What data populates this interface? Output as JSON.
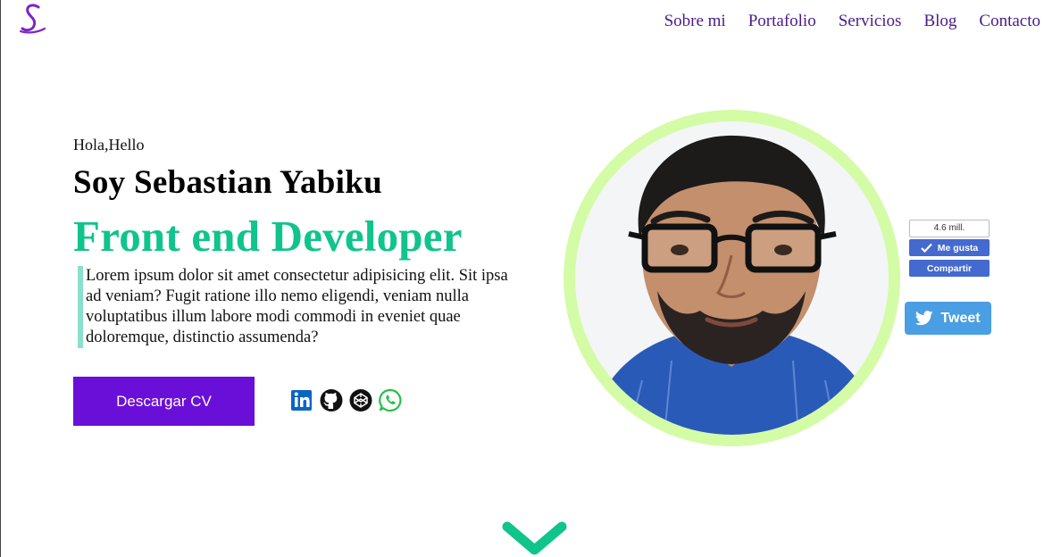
{
  "logo": {
    "glyph": "S",
    "icon": "signature-logo",
    "color": "#7a26c8"
  },
  "nav": {
    "items": [
      "Sobre mi",
      "Portafolio",
      "Servicios",
      "Blog",
      "Contacto"
    ],
    "color": "#4a1a8a"
  },
  "hero": {
    "greeting": "Hola,Hello",
    "name": "Soy Sebastian Yabiku",
    "role": "Front end Developer",
    "bio": "Lorem ipsum dolor sit amet consectetur adipisicing elit. Sit ipsa ad veniam? Fugit ratione illo nemo eligendi, veniam nulla voluptatibus illum labore modi commodi in eveniet quae doloremque, distinctio assumenda?",
    "cv_button": "Descargar CV",
    "accent_color": "#10c48c",
    "button_color": "#6a0fd8"
  },
  "socials": [
    "linkedin-icon",
    "github-icon",
    "codepen-icon",
    "whatsapp-icon"
  ],
  "facebook": {
    "count": "4.6 mill.",
    "like": "Me gusta",
    "share": "Compartir"
  },
  "twitter": {
    "label": "Tweet"
  },
  "scroll": {
    "icon": "chevron-down-icon"
  }
}
